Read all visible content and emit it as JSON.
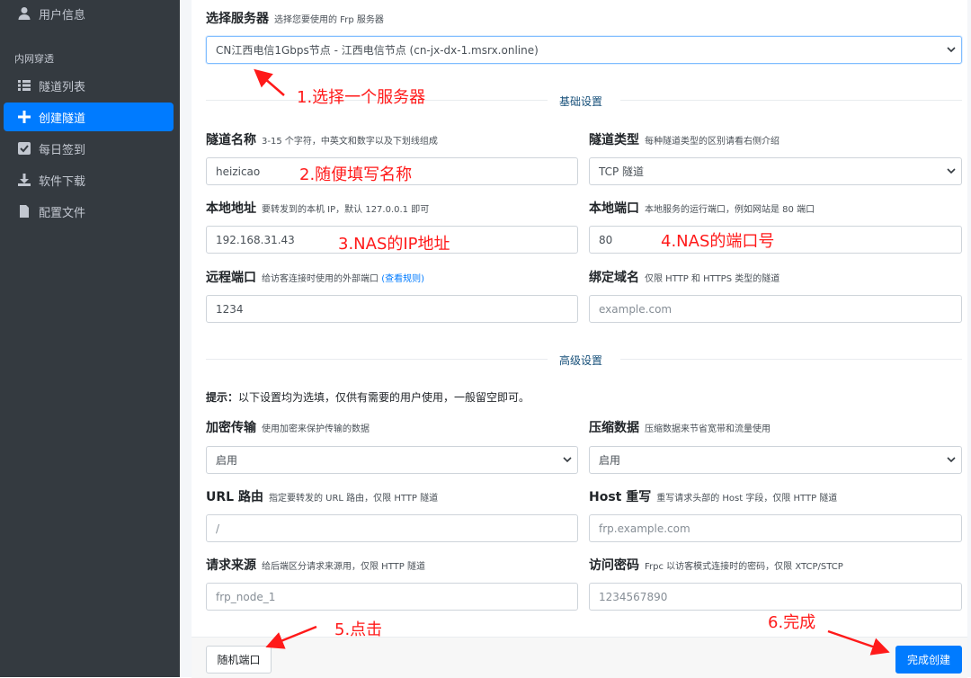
{
  "sidebar": {
    "user_info": "用户信息",
    "section_header": "内网穿透",
    "items": [
      "隧道列表",
      "创建隧道",
      "每日签到",
      "软件下载",
      "配置文件"
    ]
  },
  "server": {
    "label": "选择服务器",
    "hint": "选择您要使用的 Frp 服务器",
    "value": "CN江西电信1Gbps节点 - 江西电信节点 (cn-jx-dx-1.msrx.online)"
  },
  "sections": {
    "basic": "基础设置",
    "advanced": "高级设置"
  },
  "fields": {
    "tunnel_name": {
      "label": "隧道名称",
      "hint": "3-15 个字符，中英文和数字以及下划线组成",
      "value": "heizicao"
    },
    "tunnel_type": {
      "label": "隧道类型",
      "hint": "每种隧道类型的区别请看右侧介绍",
      "value": "TCP 隧道"
    },
    "local_addr": {
      "label": "本地地址",
      "hint": "要转发到的本机 IP，默认 127.0.0.1 即可",
      "value": "192.168.31.43"
    },
    "local_port": {
      "label": "本地端口",
      "hint": "本地服务的运行端口，例如网站是 80 端口",
      "value": "80"
    },
    "remote_port": {
      "label": "远程端口",
      "hint": "给访客连接时使用的外部端口",
      "hint_link": "(查看规则)",
      "value": "1234"
    },
    "bind_domain": {
      "label": "绑定域名",
      "hint": "仅限 HTTP 和 HTTPS 类型的隧道",
      "placeholder": "example.com"
    },
    "encrypt": {
      "label": "加密传输",
      "hint": "使用加密来保护传输的数据",
      "value": "启用"
    },
    "compress": {
      "label": "压缩数据",
      "hint": "压缩数据来节省宽带和流量使用",
      "value": "启用"
    },
    "url_route": {
      "label": "URL 路由",
      "hint": "指定要转发的 URL 路由，仅限 HTTP 隧道",
      "placeholder": "/"
    },
    "host_rewrite": {
      "label": "Host 重写",
      "hint": "重写请求头部的 Host 字段，仅限 HTTP 隧道",
      "placeholder": "frp.example.com"
    },
    "req_source": {
      "label": "请求来源",
      "hint": "给后端区分请求来源用，仅限 HTTP 隧道",
      "placeholder": "frp_node_1"
    },
    "visit_pwd": {
      "label": "访问密码",
      "hint": "Frpc 以访客模式连接时的密码，仅限 XTCP/STCP",
      "placeholder": "1234567890"
    }
  },
  "tip": {
    "prefix": "提示：",
    "text": "以下设置均为选填，仅供有需要的用户使用，一般留空即可。"
  },
  "buttons": {
    "random_port": "随机端口",
    "finish": "完成创建"
  },
  "annotations": {
    "a1": "1.选择一个服务器",
    "a2": "2.随便填写名称",
    "a3": "3.NAS的IP地址",
    "a4": "4.NAS的端口号",
    "a5": "5.点击",
    "a6": "6.完成"
  },
  "colors": {
    "sidebar_bg": "#343a40",
    "accent": "#007bff",
    "annotation": "#ff1a1a"
  }
}
